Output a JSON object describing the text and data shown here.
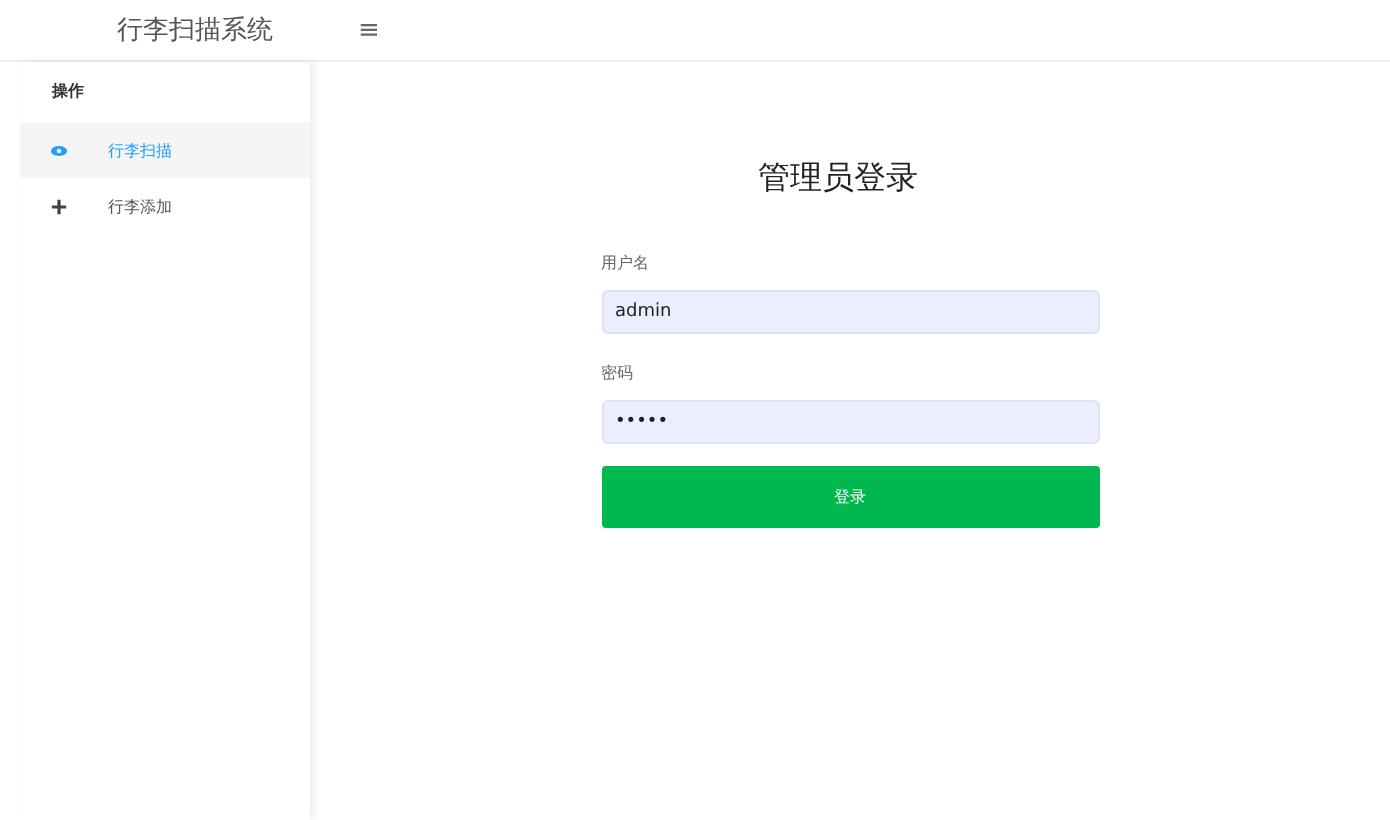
{
  "header": {
    "title": "行李扫描系统",
    "menu_icon": "≡"
  },
  "sidebar": {
    "heading": "操作",
    "items": [
      {
        "label": "行李扫描",
        "selected": true
      },
      {
        "label": "行李添加",
        "selected": false
      }
    ]
  },
  "login": {
    "title": "管理员登录",
    "fields": [
      {
        "label": "用户名",
        "value": "admin"
      },
      {
        "label": "密码",
        "value": "•••••"
      }
    ],
    "button": "登录"
  }
}
